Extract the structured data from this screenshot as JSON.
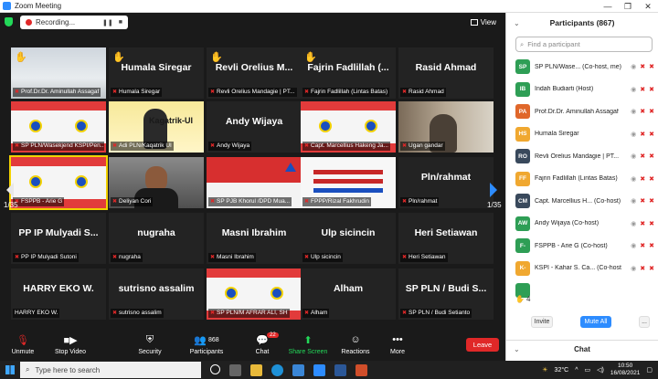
{
  "window": {
    "title": "Zoom Meeting",
    "controls": [
      "—",
      "❐",
      "✕"
    ]
  },
  "recording": {
    "label": "Recording...",
    "pause": "❚❚",
    "stop": "■"
  },
  "view_button": {
    "label": "View"
  },
  "pager": {
    "left": "1/35",
    "right": "1/35"
  },
  "tiles": [
    {
      "type": "video",
      "video": "snow",
      "hand": true,
      "label": "Prof.Dr.Dr. Aminullah Assagaf",
      "muted": true
    },
    {
      "type": "name",
      "hand": true,
      "name": "Humala Siregar",
      "label": "Humala Siregar",
      "muted": true
    },
    {
      "type": "name",
      "hand": true,
      "name": "Revli Orelius M...",
      "label": "Revli Orelius Mandagie | PT...",
      "muted": true
    },
    {
      "type": "name",
      "hand": true,
      "name": "Fajrin Fadlillah (...",
      "label": "Fajrin Fadlillah (Lintas Batas)",
      "muted": true
    },
    {
      "type": "name",
      "hand": false,
      "name": "Rasid Ahmad",
      "label": "Rasid Ahmad",
      "muted": true
    },
    {
      "type": "video",
      "video": "banner",
      "label": "SP PLN/Wasekjend KSPI/Pen...",
      "muted": true
    },
    {
      "type": "video",
      "video": "yellow",
      "label": "Adi PLN/Kaqatrik UI",
      "muted": true,
      "overlay": "Kagatrik-UI"
    },
    {
      "type": "name",
      "hand": false,
      "name": "Andy Wijaya",
      "label": "Andy Wijaya",
      "muted": true
    },
    {
      "type": "video",
      "video": "banner2",
      "label": "Capt. Marcellius Hakeng Ja...",
      "muted": true
    },
    {
      "type": "video",
      "video": "room",
      "label": "Ugan gandar",
      "muted": true
    },
    {
      "type": "video",
      "video": "banner3",
      "active": true,
      "label": "FSPPB - Arie G",
      "muted": true
    },
    {
      "type": "video",
      "video": "man",
      "label": "Deliyan Cori",
      "muted": true
    },
    {
      "type": "video",
      "video": "red",
      "label": "SP PJB Khorul /DPD Mua...",
      "muted": true
    },
    {
      "type": "video",
      "video": "slide",
      "label": "FPPP/Rizal Fakhrudin",
      "muted": true
    },
    {
      "type": "name",
      "hand": false,
      "name": "Pln/rahmat",
      "label": "Pln/rahmat",
      "muted": true
    },
    {
      "type": "name",
      "hand": false,
      "name": "PP IP Mulyadi S...",
      "label": "PP IP Mulyadi Sutoni",
      "muted": true
    },
    {
      "type": "name",
      "hand": false,
      "name": "nugraha",
      "label": "nugraha",
      "muted": true
    },
    {
      "type": "name",
      "hand": false,
      "name": "Masni Ibrahim",
      "label": "Masni Ibrahim",
      "muted": true
    },
    {
      "type": "name",
      "hand": false,
      "name": "Ulp sicincin",
      "label": "Ulp sicincin",
      "muted": true
    },
    {
      "type": "name",
      "hand": false,
      "name": "Heri Setiawan",
      "label": "Heri Setiawan",
      "muted": true
    },
    {
      "type": "name",
      "hand": false,
      "name": "HARRY EKO W.",
      "label": "HARRY EKO W.",
      "muted": false
    },
    {
      "type": "name",
      "hand": false,
      "name": "sutrisno assalim",
      "label": "sutrisno assalim",
      "muted": true
    },
    {
      "type": "video",
      "video": "banner4",
      "label": "SP PLN/M AFRAR ALI, SH",
      "muted": true
    },
    {
      "type": "name",
      "hand": false,
      "name": "Alham",
      "label": "Alham",
      "muted": true
    },
    {
      "type": "name",
      "hand": false,
      "name": "SP PLN / Budi S...",
      "label": "SP PLN / Budi Setianto",
      "muted": true
    }
  ],
  "toolbar": {
    "unmute": "Unmute",
    "stop_video": "Stop Video",
    "security": "Security",
    "participants": "Participants",
    "participants_count": "868",
    "chat": "Chat",
    "chat_badge": "22",
    "share_screen": "Share Screen",
    "reactions": "Reactions",
    "more": "More",
    "leave": "Leave"
  },
  "panel": {
    "title": "Participants (867)",
    "search_placeholder": "Find a participant",
    "participants": [
      {
        "initials": "SP",
        "color": "#2e9e55",
        "name": "SP PLN/Wase... (Co-host, me)"
      },
      {
        "initials": "IB",
        "color": "#2e9e55",
        "name": "Indah Budiarti (Host)"
      },
      {
        "initials": "PA",
        "color": "#e0672a",
        "name": "Prof.Dr.Dr. Aminullah Assagaf"
      },
      {
        "initials": "HS",
        "color": "#f0a830",
        "name": "Humala Siregar"
      },
      {
        "initials": "RO",
        "color": "#39495c",
        "name": "Revli Orelius Mandagie | PT..."
      },
      {
        "initials": "FF",
        "color": "#f0a830",
        "name": "Fajrin Fadlillah (Lintas Batas)"
      },
      {
        "initials": "CM",
        "color": "#39495c",
        "name": "Capt. Marcellius H... (Co-host)"
      },
      {
        "initials": "AW",
        "color": "#2e9e55",
        "name": "Andy Wijaya (Co-host)"
      },
      {
        "initials": "F-",
        "color": "#2e9e55",
        "name": "FSPPB - Arie G (Co-host)"
      },
      {
        "initials": "K-",
        "color": "#f0a830",
        "name": "KSPI - Kahar S. Ca... (Co-host)"
      },
      {
        "initials": "",
        "color": "#2e9e55",
        "name": ""
      }
    ],
    "raised_count": "4",
    "invite": "Invite",
    "mute_all": "Mute All",
    "more": "...",
    "chat": "Chat"
  },
  "taskbar": {
    "search_placeholder": "Type here to search",
    "weather": "32°C",
    "time": "10:50",
    "date": "16/08/2021"
  }
}
